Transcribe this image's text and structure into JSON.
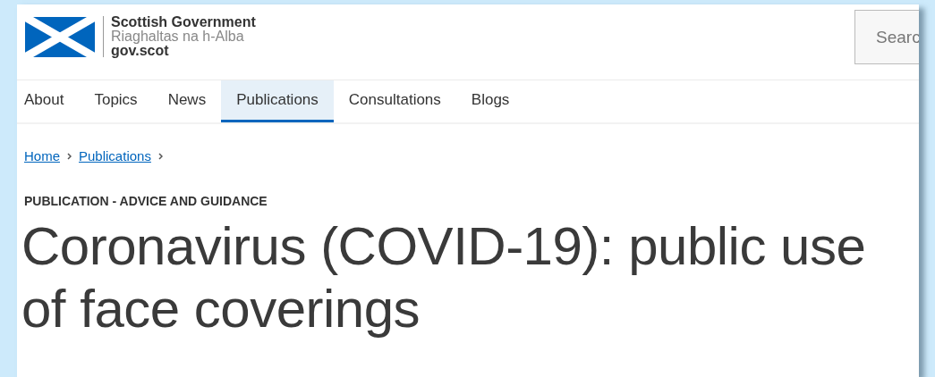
{
  "header": {
    "logo": {
      "name": "Scottish Government",
      "gaelic_name": "Riaghaltas na h-Alba",
      "domain": "gov.scot"
    },
    "search": {
      "placeholder": "Searc"
    }
  },
  "nav": [
    {
      "label": "About",
      "selected": false
    },
    {
      "label": "Topics",
      "selected": false
    },
    {
      "label": "News",
      "selected": false
    },
    {
      "label": "Publications",
      "selected": true
    },
    {
      "label": "Consultations",
      "selected": false
    },
    {
      "label": "Blogs",
      "selected": false
    }
  ],
  "breadcrumb": [
    "Home",
    "Publications"
  ],
  "content": {
    "category": "PUBLICATION - ADVICE AND GUIDANCE",
    "title": "Coronavirus (COVID-19): public use of face coverings"
  }
}
